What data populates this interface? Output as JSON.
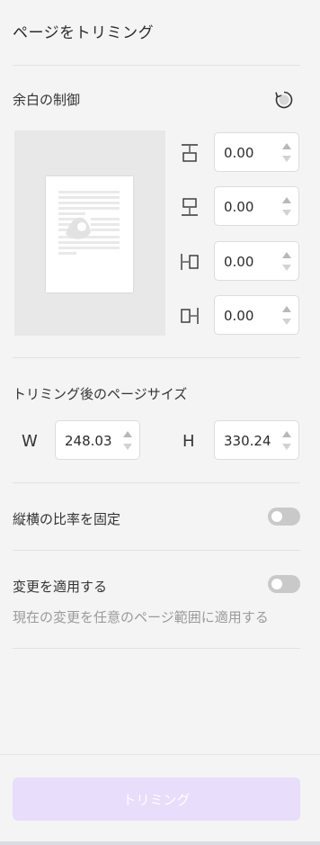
{
  "panel": {
    "title": "ページをトリミング"
  },
  "margins": {
    "label": "余白の制御",
    "fields": [
      {
        "name": "top",
        "icon": "margin-top-icon",
        "value": "0.00"
      },
      {
        "name": "bottom",
        "icon": "margin-bottom-icon",
        "value": "0.00"
      },
      {
        "name": "left",
        "icon": "margin-left-icon",
        "value": "0.00"
      },
      {
        "name": "right",
        "icon": "margin-right-icon",
        "value": "0.00"
      }
    ]
  },
  "page_size": {
    "label": "トリミング後のページサイズ",
    "width_label": "W",
    "width_value": "248.03",
    "height_label": "H",
    "height_value": "330.24"
  },
  "aspect_ratio": {
    "label": "縦横の比率を固定",
    "enabled": false
  },
  "apply_changes": {
    "label": "変更を適用する",
    "description": "現在の変更を任意のページ範囲に適用する",
    "enabled": false
  },
  "actions": {
    "trim_label": "トリミング"
  },
  "colors": {
    "background": "#f4f4f4",
    "button_disabled": "#e8ddfa",
    "toggle_off": "#c9c9c9"
  }
}
